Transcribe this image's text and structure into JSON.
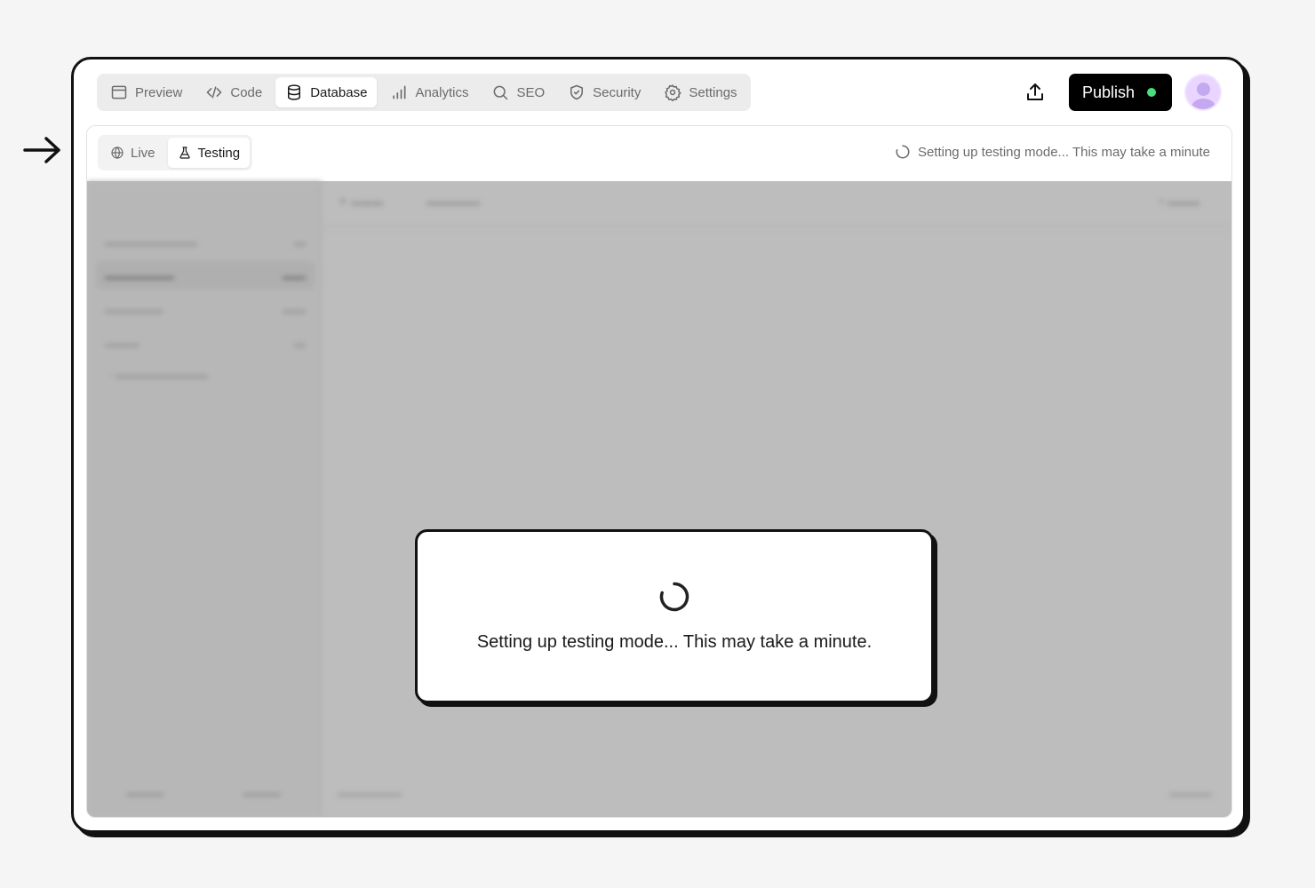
{
  "nav": {
    "tabs": [
      {
        "label": "Preview",
        "icon": "preview-window-icon"
      },
      {
        "label": "Code",
        "icon": "code-icon"
      },
      {
        "label": "Database",
        "icon": "database-icon"
      },
      {
        "label": "Analytics",
        "icon": "analytics-icon"
      },
      {
        "label": "SEO",
        "icon": "search-icon"
      },
      {
        "label": "Security",
        "icon": "shield-icon"
      },
      {
        "label": "Settings",
        "icon": "gear-icon"
      }
    ],
    "active_tab": "Database"
  },
  "header": {
    "share_icon": "upload-icon",
    "publish_label": "Publish",
    "publish_status_color": "#4ade80"
  },
  "mode": {
    "live_label": "Live",
    "testing_label": "Testing",
    "active": "Testing",
    "status_text": "Setting up testing mode... This may take a minute"
  },
  "modal": {
    "message": "Setting up testing mode... This may take a minute."
  }
}
